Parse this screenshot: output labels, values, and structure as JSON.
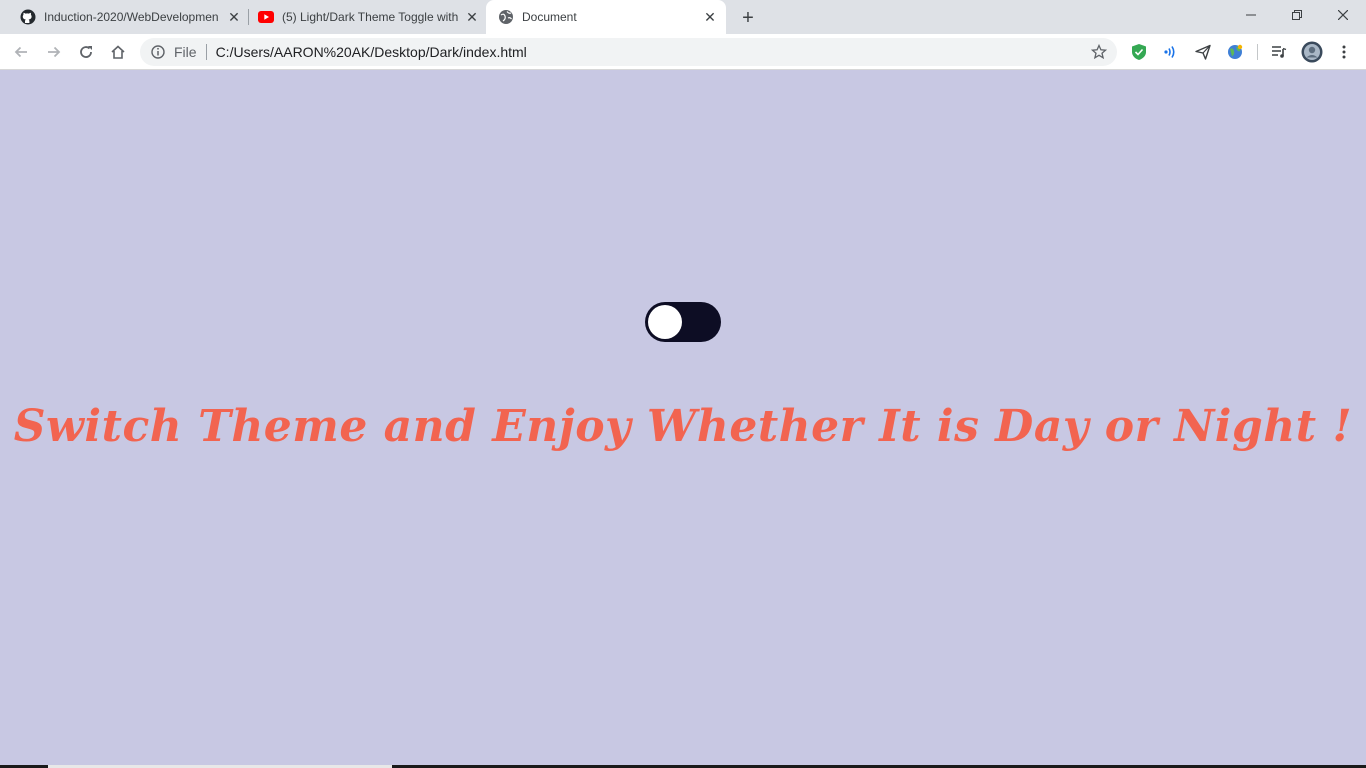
{
  "tabs": [
    {
      "title": "Induction-2020/WebDevelopmen",
      "icon": "github-icon"
    },
    {
      "title": "(5) Light/Dark Theme Toggle with",
      "icon": "youtube-icon"
    },
    {
      "title": "Document",
      "icon": "globe-icon",
      "active": true
    }
  ],
  "address_bar": {
    "scheme_label": "File",
    "url": "C:/Users/AARON%20AK/Desktop/Dark/index.html"
  },
  "page": {
    "background_color": "#c8c8e3",
    "headline": "Switch Theme and Enjoy Whether It is Day or Night !",
    "headline_color": "#f26450",
    "toggle": {
      "state": "off",
      "track_color": "#0d0d24",
      "knob_color": "#ffffff"
    }
  }
}
